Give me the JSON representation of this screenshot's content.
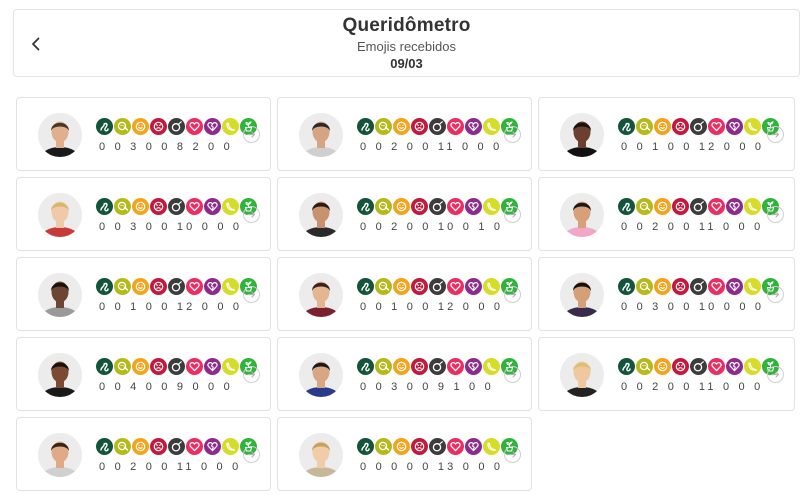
{
  "header": {
    "title": "Queridômetro",
    "subtitle": "Emojis recebidos",
    "date": "09/03",
    "back_icon": "chevron-left-icon"
  },
  "emoji_types": [
    {
      "name": "snake-icon",
      "color": "#14543a"
    },
    {
      "name": "liar-face-icon",
      "color": "#b6b91c"
    },
    {
      "name": "smile-face-icon",
      "color": "#f4a41c"
    },
    {
      "name": "angry-face-icon",
      "color": "#c3193c"
    },
    {
      "name": "bomb-icon",
      "color": "#3c3c3c"
    },
    {
      "name": "heart-icon",
      "color": "#ea2d62"
    },
    {
      "name": "broken-heart-icon",
      "color": "#8e2a8c"
    },
    {
      "name": "banana-icon",
      "color": "#d6dc27"
    },
    {
      "name": "plant-icon",
      "color": "#2fb33a"
    }
  ],
  "participants": [
    {
      "counts": "0 0 3 0 0 8 2 0 0",
      "skin": "#e0b08e",
      "hair": "#4a3728",
      "shirt": "#1a1a1a"
    },
    {
      "counts": "0 0 2 0 0 11 0 0 0",
      "skin": "#d4a483",
      "hair": "#2a2a2a",
      "shirt": "#cfcfcf"
    },
    {
      "counts": "0 0 1 0 0 12 0 0 0",
      "skin": "#6b4030",
      "hair": "#1a1208",
      "shirt": "#111111"
    },
    {
      "counts": "0 0 3 0 0 10 0 0 0",
      "skin": "#f0caa8",
      "hair": "#d9b66a",
      "shirt": "#c83a3a"
    },
    {
      "counts": "0 0 2 0 0 10 0 1 0",
      "skin": "#c7926c",
      "hair": "#2b1c12",
      "shirt": "#2a2a2a"
    },
    {
      "counts": "0 0 2 0 0 11 0 0 0",
      "skin": "#d8a07a",
      "hair": "#1a1a1a",
      "shirt": "#f2a6c8"
    },
    {
      "counts": "0 0 1 0 0 12 0 0 0",
      "skin": "#6e4532",
      "hair": "#1a1208",
      "shirt": "#9a9a9a"
    },
    {
      "counts": "0 0 1 0 0 12 0 0 0",
      "skin": "#e3b591",
      "hair": "#3a2418",
      "shirt": "#7a2030"
    },
    {
      "counts": "0 0 3 0 0 10 0 0 0",
      "skin": "#d3a07a",
      "hair": "#111111",
      "shirt": "#3a2a4a"
    },
    {
      "counts": "0 0 4 0 0 9 0 0 0",
      "skin": "#7a4a32",
      "hair": "#1a1208",
      "shirt": "#1a1a1a"
    },
    {
      "counts": "0 0 3 0 0 9 1 0 0",
      "skin": "#d9a683",
      "hair": "#1a1a1a",
      "shirt": "#2a3a8a"
    },
    {
      "counts": "0 0 2 0 0 11 0 0 0",
      "skin": "#f0c8a0",
      "hair": "#e0c070",
      "shirt": "#222222"
    },
    {
      "counts": "0 0 2 0 0 11 0 0 0",
      "skin": "#e0aa86",
      "hair": "#3a2418",
      "shirt": "#d0d0d0"
    },
    {
      "counts": "0 0 0 0 0 13 0 0 0",
      "skin": "#f0cca8",
      "hair": "#c8a060",
      "shirt": "#c8b89a"
    }
  ]
}
